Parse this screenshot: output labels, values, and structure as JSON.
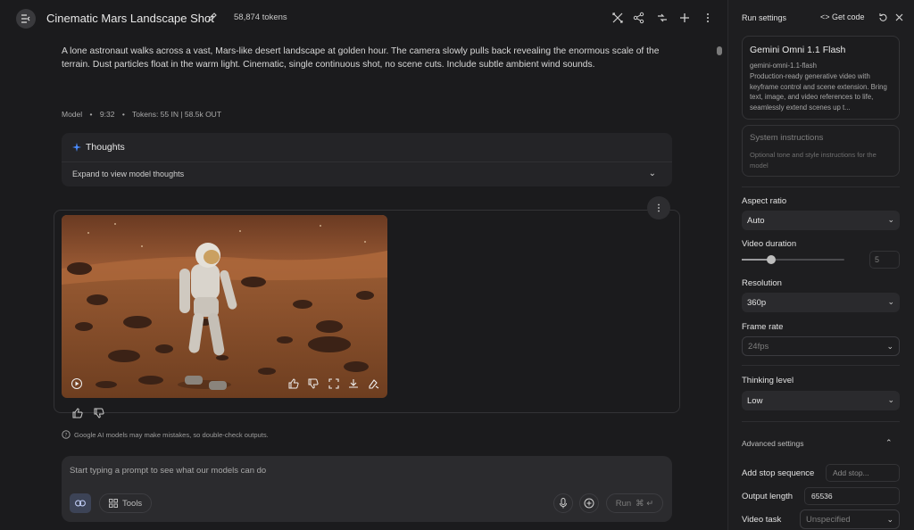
{
  "header": {
    "title": "Cinematic Mars Landscape Shot",
    "tokens": "58,874 tokens"
  },
  "prompt": {
    "text": "A lone astronaut walks across a vast, Mars-like desert landscape at golden hour. The camera slowly pulls back revealing the enormous scale of the terrain. Dust particles float in the warm light. Cinematic, single continuous shot, no scene cuts. Include subtle ambient wind sounds."
  },
  "response_meta": {
    "role": "Model",
    "time": "9:32",
    "token_info": "Tokens: 55 IN | 58.5k OUT"
  },
  "thoughts": {
    "title": "Thoughts",
    "expand_label": "Expand to view model thoughts"
  },
  "disclaimer": "Google AI models may make mistakes, so double-check outputs.",
  "composer": {
    "placeholder": "Start typing a prompt to see what our models can do",
    "tools_label": "Tools",
    "run_label": "Run",
    "run_shortcut": "⌘ ↵"
  },
  "panel": {
    "title": "Run settings",
    "get_code_label": "Get code",
    "model": {
      "name": "Gemini Omni 1.1 Flash",
      "id": "gemini-omni-1.1-flash",
      "description": "Production-ready generative video with keyframe control and scene extension. Bring text, image, and video references to life, seamlessly extend scenes up t..."
    },
    "system_instructions": {
      "title": "System instructions",
      "placeholder": "Optional tone and style instructions for the model"
    },
    "aspect_ratio": {
      "label": "Aspect ratio",
      "value": "Auto"
    },
    "video_duration": {
      "label": "Video duration",
      "value": "5",
      "fraction": 0.29
    },
    "resolution": {
      "label": "Resolution",
      "value": "360p"
    },
    "frame_rate": {
      "label": "Frame rate",
      "value": "24fps"
    },
    "thinking_level": {
      "label": "Thinking level",
      "value": "Low"
    },
    "advanced_label": "Advanced settings",
    "stop_sequence": {
      "label": "Add stop sequence",
      "placeholder": "Add stop..."
    },
    "output_length": {
      "label": "Output length",
      "value": "65536"
    },
    "video_task": {
      "label": "Video task",
      "value": "Unspecified"
    }
  },
  "colors": {
    "background": "#1b1b1d",
    "panel": "#1e1e20",
    "accent": "#4a8cff"
  }
}
